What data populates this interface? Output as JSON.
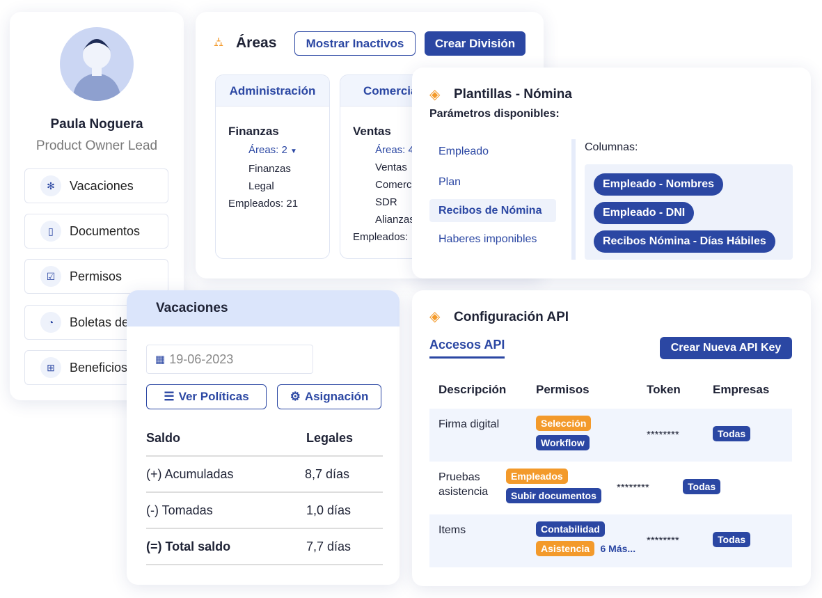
{
  "profile": {
    "name": "Paula Noguera",
    "role": "Product Owner Lead",
    "menu": [
      {
        "label": "Vacaciones",
        "icon": "palm-tree-icon"
      },
      {
        "label": "Documentos",
        "icon": "document-icon"
      },
      {
        "label": "Permisos",
        "icon": "laptop-check-icon"
      },
      {
        "label": "Boletas de",
        "icon": "piggy-bank-icon"
      },
      {
        "label": "Beneficios",
        "icon": "gift-icon"
      }
    ]
  },
  "areas": {
    "title": "Áreas",
    "show_inactive": "Mostrar Inactivos",
    "create_division": "Crear División",
    "divisions": [
      {
        "name": "Administración",
        "group": "Finanzas",
        "areas_label": "Áreas: 2",
        "items": [
          "Finanzas",
          "Legal"
        ],
        "employees": "Empleados: 21"
      },
      {
        "name": "Comercial",
        "group": "Ventas",
        "areas_label": "Áreas: 4",
        "items": [
          "Ventas",
          "Comercial",
          "SDR",
          "Alianzas"
        ],
        "employees": "Empleados:"
      }
    ]
  },
  "plantillas": {
    "title": "Plantillas - Nómina",
    "subtitle": "Parámetros disponibles:",
    "params": [
      "Empleado",
      "Plan",
      "Recibos de Nómina",
      "Haberes imponibles"
    ],
    "selected": "Recibos de Nómina",
    "columns_label": "Columnas:",
    "columns": [
      "Empleado - Nombres",
      "Empleado - DNI",
      "Recibos Nómina - Días Hábiles"
    ]
  },
  "vacaciones": {
    "title": "Vacaciones",
    "date": "19-06-2023",
    "ver_politicas": "Ver Políticas",
    "asignacion": "Asignación",
    "headers": [
      "Saldo",
      "Legales"
    ],
    "rows": [
      {
        "label": "(+) Acumuladas",
        "value": "8,7 días"
      },
      {
        "label": "(-) Tomadas",
        "value": "1,0 días"
      },
      {
        "label": "(=) Total saldo",
        "value": "7,7 días"
      }
    ]
  },
  "api": {
    "title": "Configuración API",
    "tab": "Accesos API",
    "create": "Crear Nueva API Key",
    "headers": [
      "Descripción",
      "Permisos",
      "Token",
      "Empresas"
    ],
    "rows": [
      {
        "desc": "Firma digital",
        "perms": [
          {
            "label": "Selección",
            "color": "orange"
          },
          {
            "label": "Workflow",
            "color": "blue"
          }
        ],
        "token": "********",
        "empresas": "Todas"
      },
      {
        "desc": "Pruebas asistencia",
        "perms": [
          {
            "label": "Empleados",
            "color": "orange"
          },
          {
            "label": "Subir documentos",
            "color": "blue"
          }
        ],
        "token": "********",
        "empresas": "Todas"
      },
      {
        "desc": "Items",
        "perms": [
          {
            "label": "Contabilidad",
            "color": "blue"
          },
          {
            "label": "Asistencia",
            "color": "orange"
          }
        ],
        "more": "6 Más...",
        "token": "********",
        "empresas": "Todas"
      }
    ]
  },
  "colors": {
    "primary": "#2b47a3",
    "accent": "#f39a2b",
    "header_bg": "#dbe5fb"
  }
}
